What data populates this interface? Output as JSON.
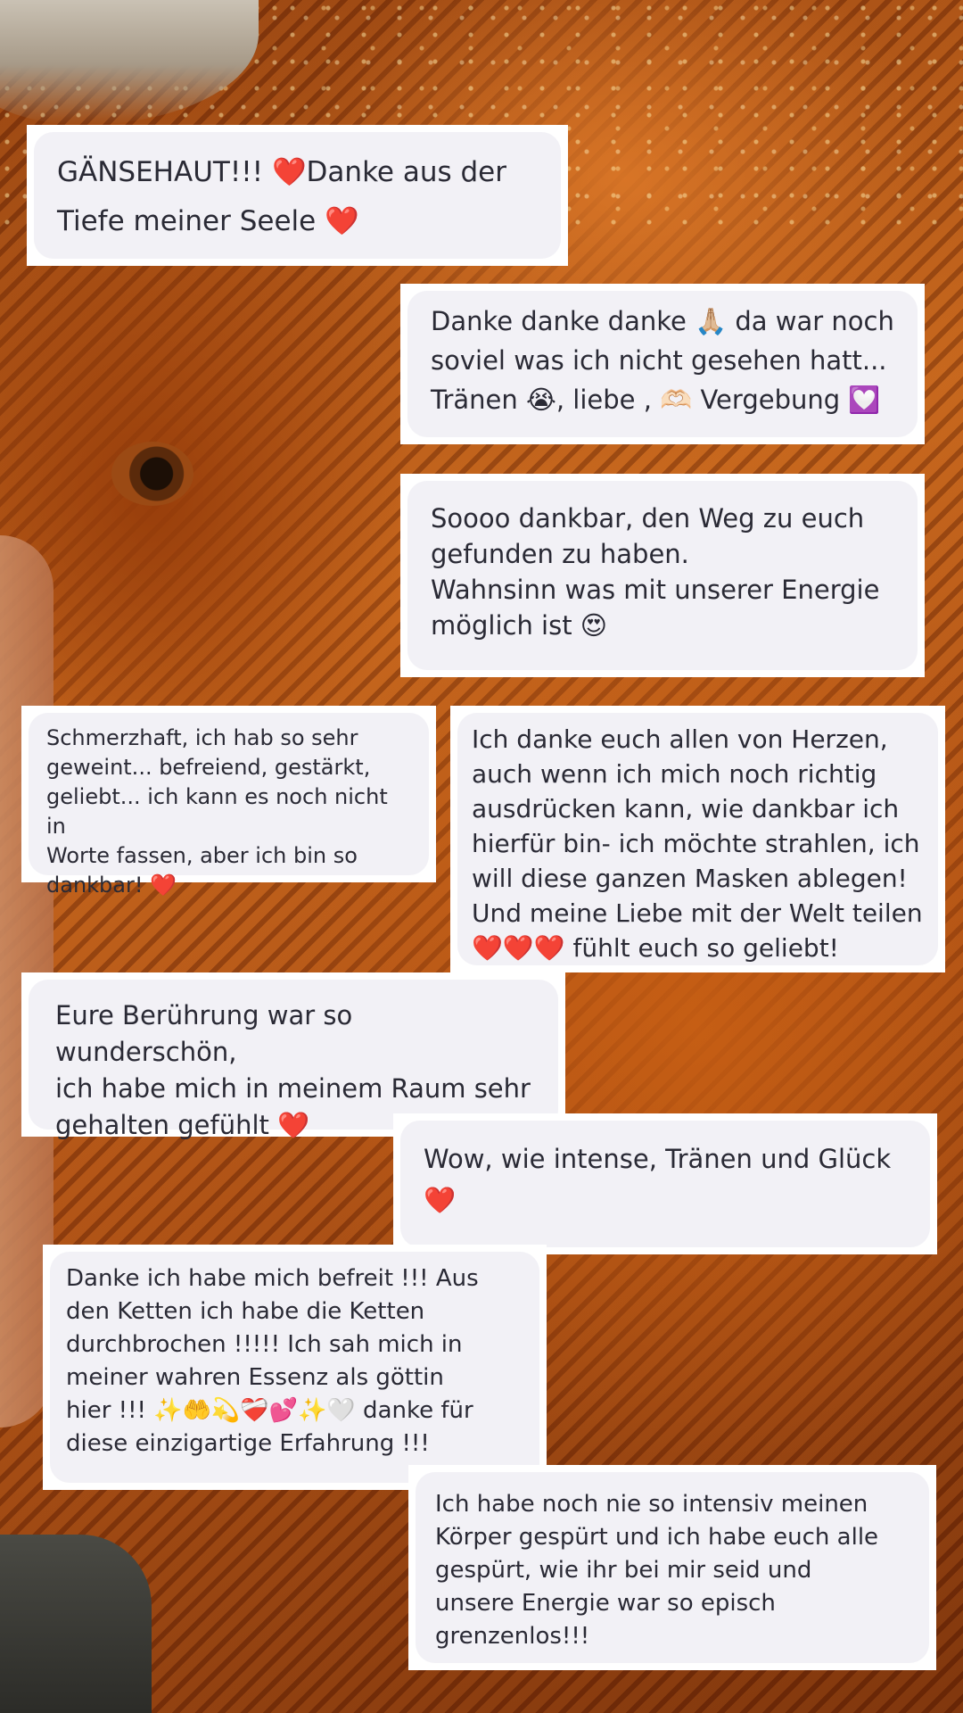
{
  "background": {
    "description_icon": "eagle-and-woman-background",
    "accent_colors": [
      "#8a3a0c",
      "#c2631a",
      "#6f2a07"
    ]
  },
  "comments": [
    {
      "text": "GÄNSEHAUT!!! ❤️Danke aus der\nTiefe meiner Seele ❤️"
    },
    {
      "text": "Danke danke danke 🙏🏼 da war noch\nsoviel was ich nicht gesehen hatt...\nTränen 😭, liebe , 🫶🏻 Vergebung 💟"
    },
    {
      "text": "Soooo dankbar, den Weg zu euch\ngefunden zu haben.\nWahnsinn was mit unserer Energie\nmöglich ist 😍"
    },
    {
      "text": "Schmerzhaft, ich hab so sehr\ngeweint... befreiend, gestärkt,\ngeliebt... ich kann es noch nicht in\nWorte fassen, aber ich bin so\ndankbar! ❤️"
    },
    {
      "text": "Ich danke euch allen von Herzen,\nauch wenn ich mich noch richtig\nausdrücken kann, wie dankbar ich\nhierfür bin- ich möchte strahlen, ich\nwill diese ganzen Masken ablegen!\nUnd meine Liebe mit der Welt teilen\n❤️❤️❤️ fühlt euch so geliebt!"
    },
    {
      "text": "Eure Berührung war so wunderschön,\nich habe mich in meinem Raum sehr\ngehalten gefühlt ❤️"
    },
    {
      "text": "Wow, wie intense, Tränen und Glück\n❤️"
    },
    {
      "text": "Danke ich habe mich befreit !!! Aus\nden Ketten ich habe die Ketten\ndurchbrochen !!!!! Ich sah mich in\nmeiner wahren Essenz als göttin\nhier !!! ✨🤲💫❤️‍🩹💕✨🤍 danke für\ndiese einzigartige Erfahrung !!!"
    },
    {
      "text": "Ich habe noch nie so intensiv meinen\nKörper gespürt und ich habe euch alle\ngespürt, wie ihr bei mir seid und\nunsere Energie war so episch\ngrenzenlos!!!"
    }
  ]
}
